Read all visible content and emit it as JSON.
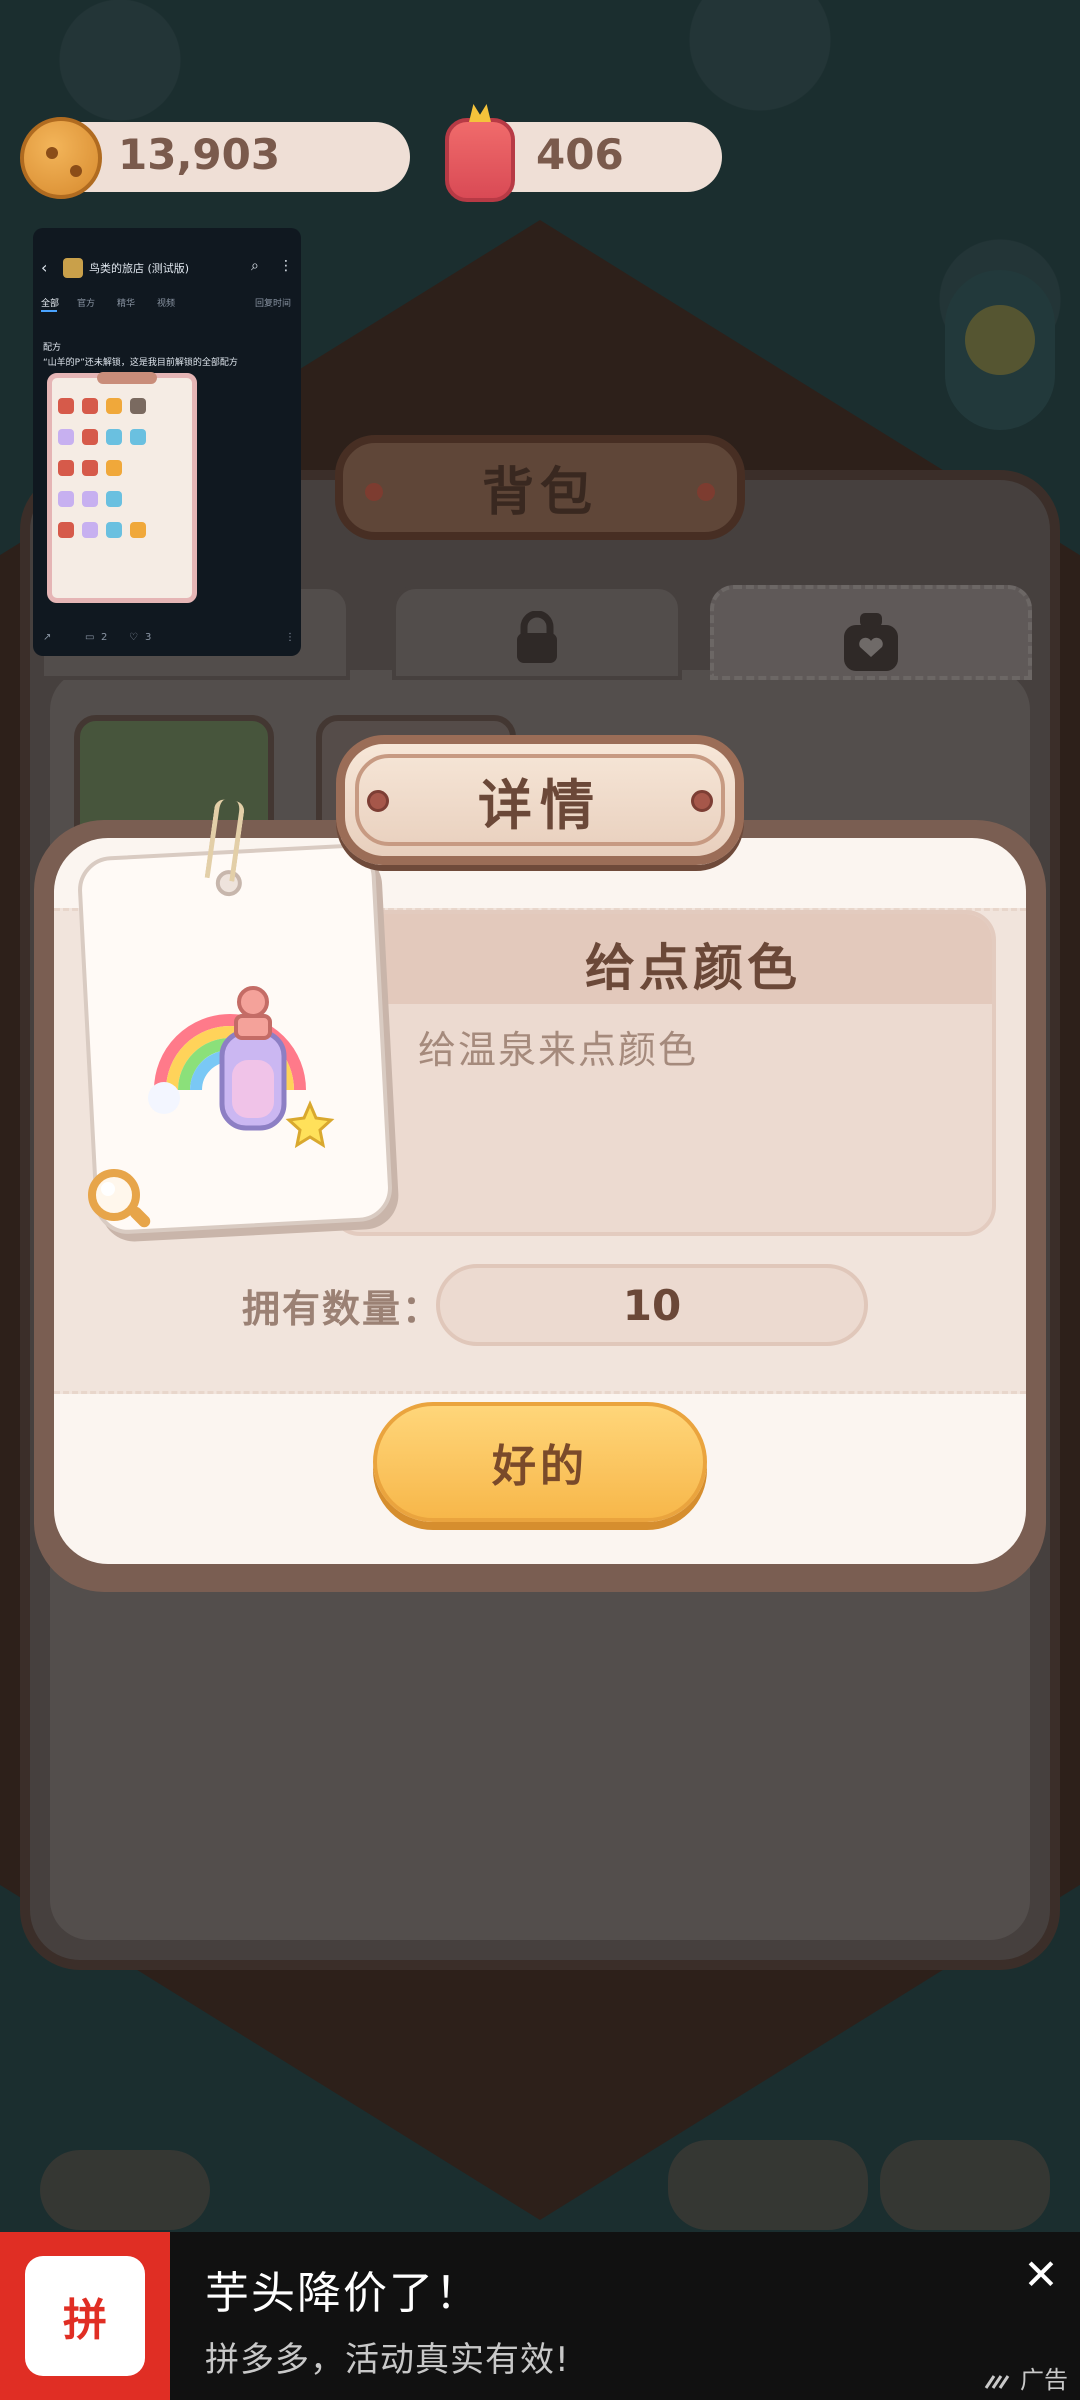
{
  "resources": {
    "cookies": "13,903",
    "gems": "406"
  },
  "backpack": {
    "title": "背包"
  },
  "pip_overlay": {
    "title": "鸟类的旅店 (测试版)",
    "tabs": [
      "全部",
      "官方",
      "精华",
      "视频"
    ],
    "sort": "回复时间",
    "line1": "配方",
    "line2": "“山羊的P”还未解锁，这是我目前解锁的全部配方",
    "comments": "2",
    "likes": "3"
  },
  "dialog": {
    "title": "详情",
    "item_name": "给点颜色",
    "item_desc": "给温泉来点颜色",
    "count_label": "拥有数量：",
    "count_value": "10",
    "ok_label": "好的"
  },
  "ad": {
    "logo_text": "拼",
    "title": "芋头降价了！",
    "subtitle": "拼多多，活动真实有效!",
    "tag": "广告",
    "close_icon": "close-icon"
  },
  "colors": {
    "plaque_border": "#9b6d57",
    "button": "#f7b74a",
    "ad_brand": "#e02e24"
  }
}
